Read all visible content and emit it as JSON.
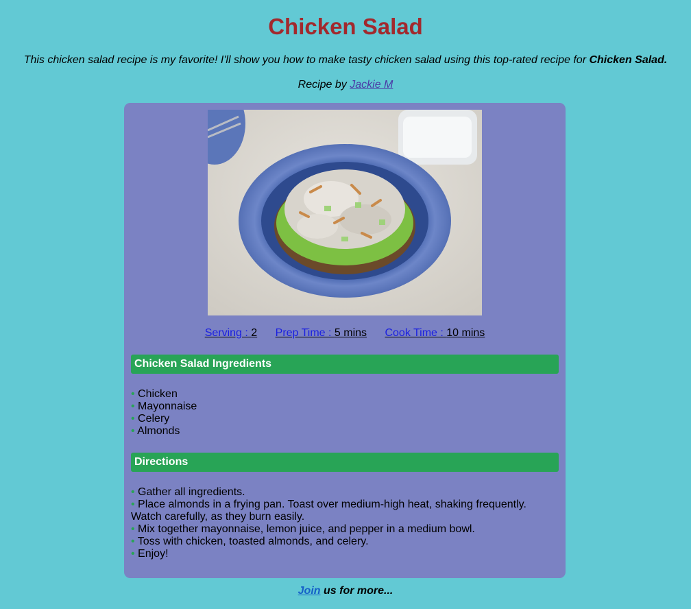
{
  "page": {
    "title": "Chicken Salad",
    "intro_text": "This chicken salad recipe is my favorite! I'll show you how to make tasty chicken salad using this top-rated recipe for ",
    "intro_bold": "Chicken Salad.",
    "byline_prefix": "Recipe by ",
    "author": "Jackie M"
  },
  "photo": {
    "description_icon": "chicken-salad-plate-photo"
  },
  "meta": {
    "serving_label": "Serving : ",
    "serving_value": "2",
    "prep_label": "Prep Time : ",
    "prep_value": "5 mins",
    "cook_label": "Cook Time : ",
    "cook_value": "10 mins"
  },
  "ingredients": {
    "heading": "Chicken Salad Ingredients",
    "items": [
      "Chicken",
      "Mayonnaise",
      "Celery",
      "Almonds"
    ]
  },
  "directions": {
    "heading": "Directions",
    "steps": [
      "Gather all ingredients.",
      "Place almonds in a frying pan. Toast over medium-high heat, shaking frequently. Watch carefully, as they burn easily.",
      "Mix together mayonnaise, lemon juice, and pepper in a medium bowl.",
      "Toss with chicken, toasted almonds, and celery.",
      "Enjoy!"
    ]
  },
  "footer": {
    "join_label": "Join",
    "suffix": " us for more..."
  },
  "colors": {
    "background": "#62c9d4",
    "card": "#7b82c3",
    "title": "#a2292d",
    "section_bar": "#28a456",
    "link": "#1a1fe0"
  }
}
